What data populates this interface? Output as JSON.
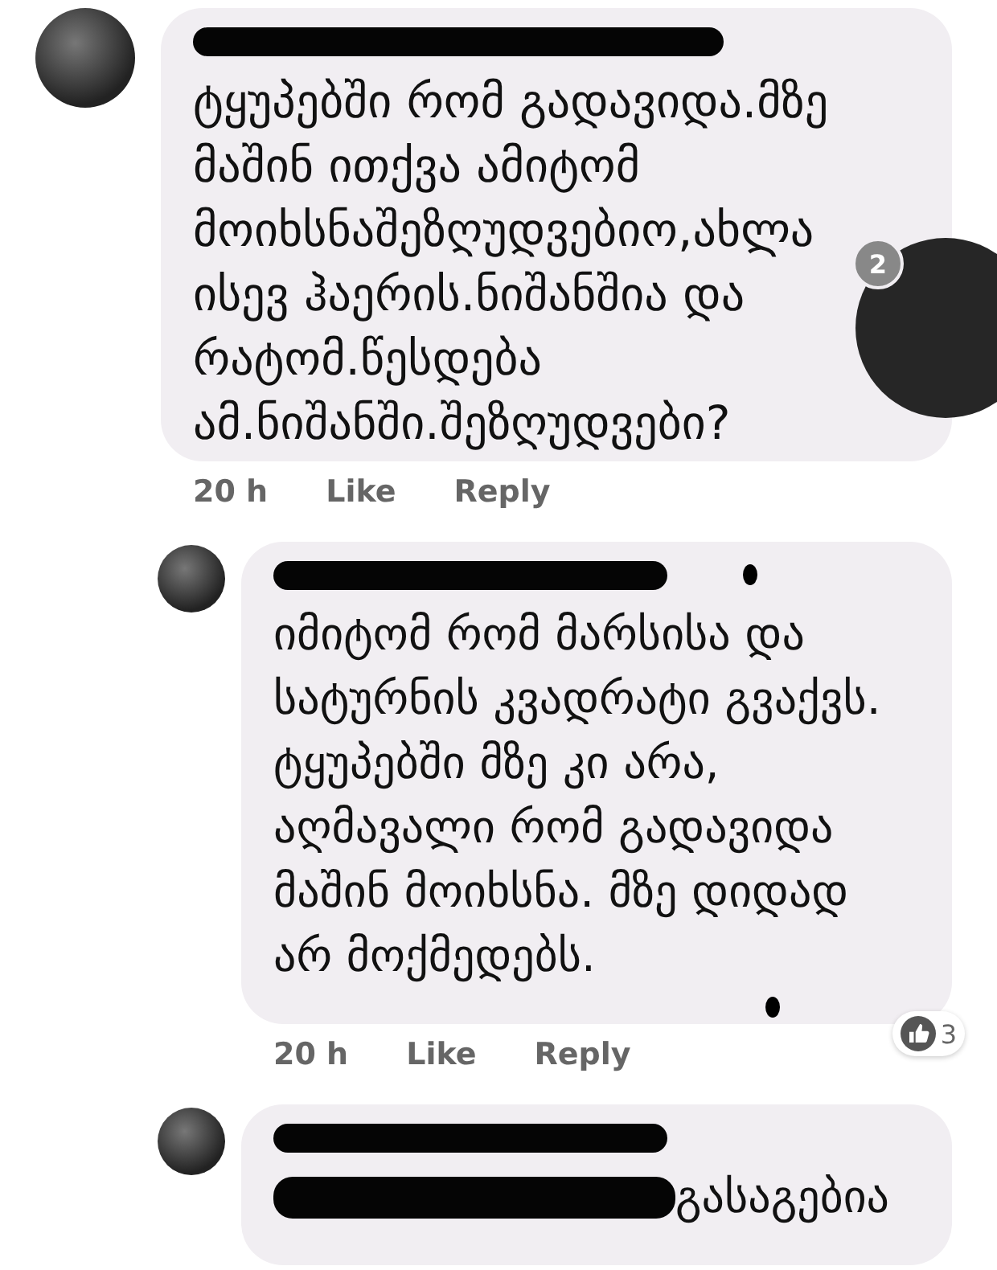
{
  "comments": [
    {
      "author": {
        "kind": "redaction"
      },
      "body": [
        {
          "kind": "text",
          "text": "ტყუპებში რომ გადავიდა.მზე\nმაშინ ითქვა ამიტომ\nმოიხსნაშეზღუდვებიო,ახლა\nისევ ჰაერის.ნიშანშია და\nრატომ.წესდება\nამ.ნიშანში.შეზღუდვები?"
        }
      ],
      "time": "20 h",
      "actions": [
        "Like",
        "Reply"
      ],
      "reply": false
    },
    {
      "author": {
        "kind": "redaction"
      },
      "body": [
        {
          "kind": "text",
          "text": "იმიტომ რომ მარსისა და\nსატურნის კვადრატი გვაქვს.\nტყუპებში მზე კი არა,\nაღმავალი რომ  გადავიდა\nმაშინ მოიხსნა. მზე დიდად\nარ მოქმედებს."
        }
      ],
      "time": "20 h",
      "actions": [
        "Like",
        "Reply"
      ],
      "reactions": "3",
      "reply": true
    },
    {
      "author": {
        "kind": "redaction"
      },
      "body": [
        {
          "kind": "redaction"
        },
        {
          "kind": "text",
          "text": "გასაგებია"
        }
      ],
      "reply": true
    }
  ],
  "chat_head": {
    "badge": "2"
  }
}
